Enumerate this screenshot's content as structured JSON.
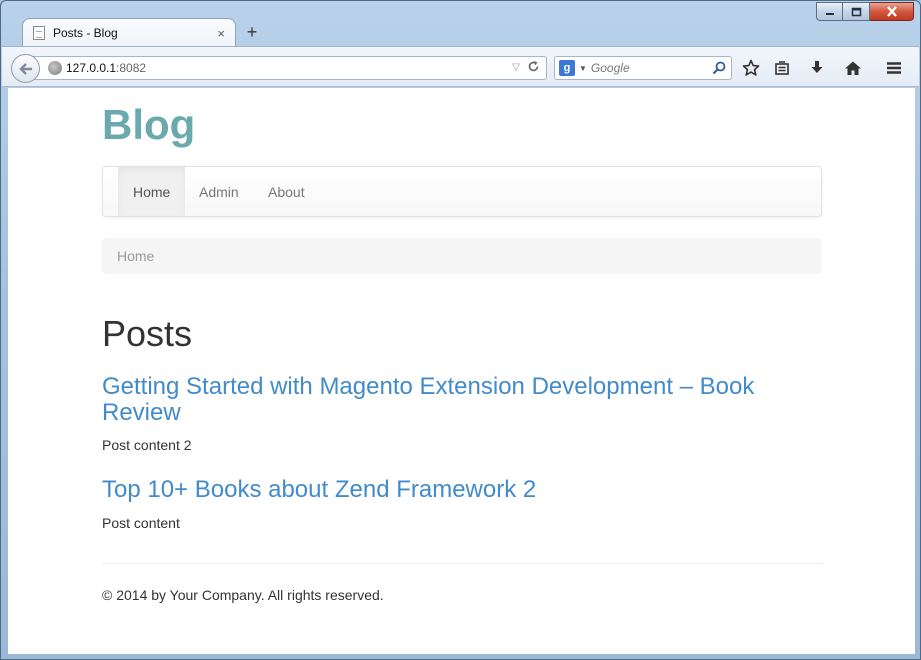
{
  "browser": {
    "tab_title": "Posts - Blog",
    "new_tab_label": "+",
    "tab_close": "×",
    "url_host": "127.0.0.1",
    "url_port": ":8082",
    "search_engine_letter": "g",
    "search_placeholder": "Google"
  },
  "site": {
    "brand": "Blog",
    "nav": [
      {
        "label": "Home",
        "active": true
      },
      {
        "label": "Admin",
        "active": false
      },
      {
        "label": "About",
        "active": false
      }
    ],
    "breadcrumb": "Home"
  },
  "main": {
    "heading": "Posts",
    "posts": [
      {
        "title": "Getting Started with Magento Extension Development – Book Review",
        "content": "Post content 2"
      },
      {
        "title": "Top 10+ Books about Zend Framework 2",
        "content": "Post content"
      }
    ]
  },
  "footer": {
    "text": "© 2014 by Your Company. All rights reserved."
  },
  "colors": {
    "brand": "#6aa9ac",
    "link": "#428bca",
    "text": "#333333"
  }
}
